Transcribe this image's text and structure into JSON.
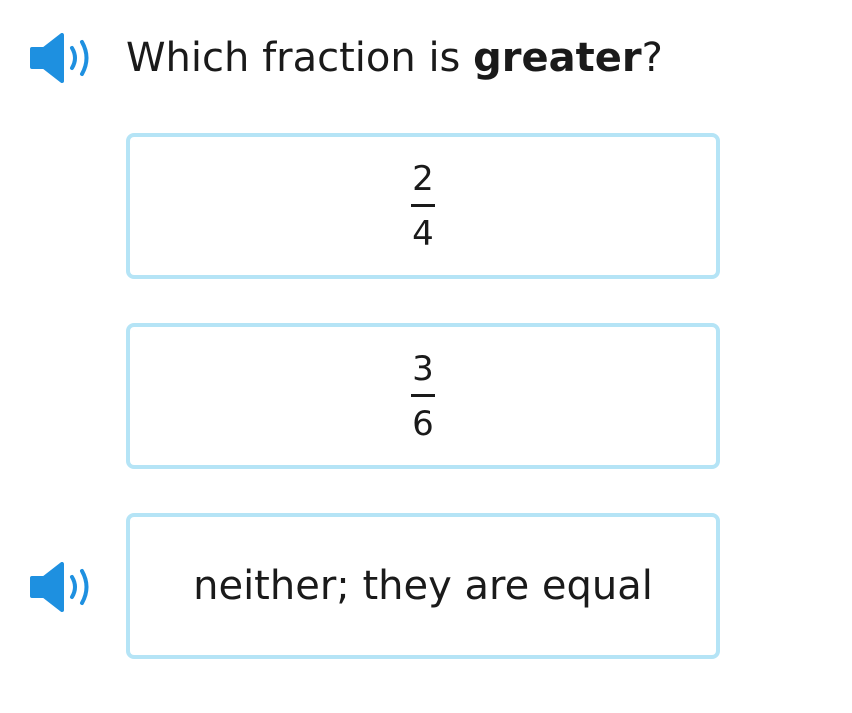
{
  "question": {
    "prefix": "Which fraction is ",
    "emphasis": "greater",
    "suffix": "?"
  },
  "choices": [
    {
      "type": "fraction",
      "numerator": "2",
      "denominator": "4"
    },
    {
      "type": "fraction",
      "numerator": "3",
      "denominator": "6"
    },
    {
      "type": "text",
      "text": "neither; they are equal"
    }
  ],
  "icons": {
    "speaker": "speaker-icon"
  },
  "colors": {
    "speaker_blue": "#1e90e0",
    "choice_border": "#b5e4f6",
    "text": "#1a1a1a"
  }
}
